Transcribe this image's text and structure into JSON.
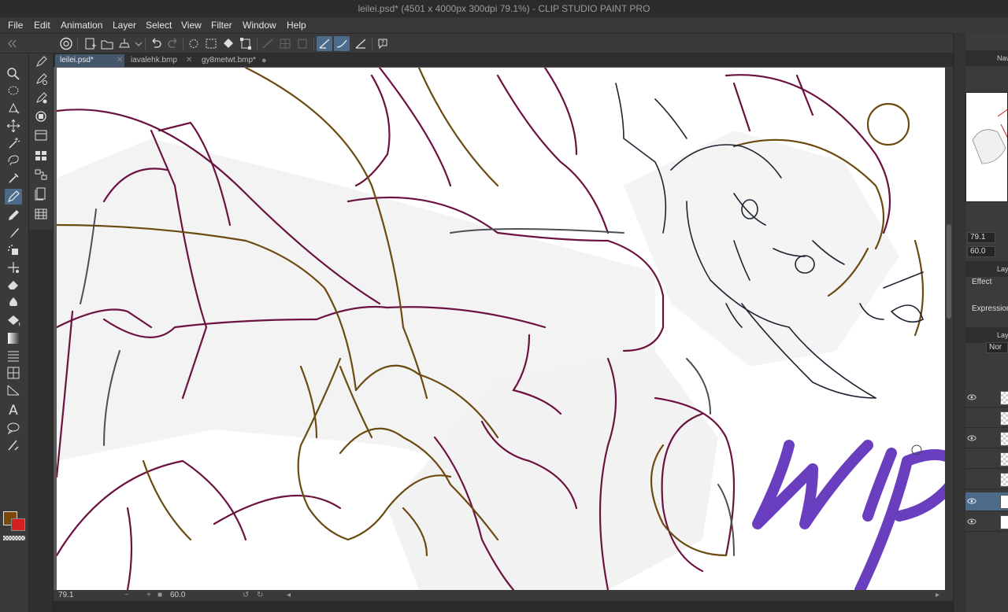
{
  "window": {
    "title": "leilei.psd* (4501 x 4000px 300dpi 79.1%)  - CLIP STUDIO PAINT PRO"
  },
  "menu": {
    "items": [
      "File",
      "Edit",
      "Animation",
      "Layer",
      "Select",
      "View",
      "Filter",
      "Window",
      "Help"
    ]
  },
  "tabs": [
    {
      "label": "leilei.psd*",
      "active": true
    },
    {
      "label": "iavalehk.bmp",
      "active": false
    },
    {
      "label": "gy8metwt.bmp*",
      "active": false
    }
  ],
  "status": {
    "zoom": "79.1",
    "angle": "60.0"
  },
  "panel": {
    "navigator_label": "Nav",
    "zoom_value": "79.1",
    "angle_value": "60.0",
    "layer_property_label": "Lay",
    "effect_label": "Effect",
    "expression_label": "Expression",
    "layer_label": "Lay",
    "blend_mode": "Nor"
  },
  "colors": {
    "main_color": "#7a4a08",
    "sub_color": "#d42020",
    "accent": "#4c6b8a",
    "watermark": "#6a3fbf"
  },
  "canvas_overlay_text": "wip"
}
